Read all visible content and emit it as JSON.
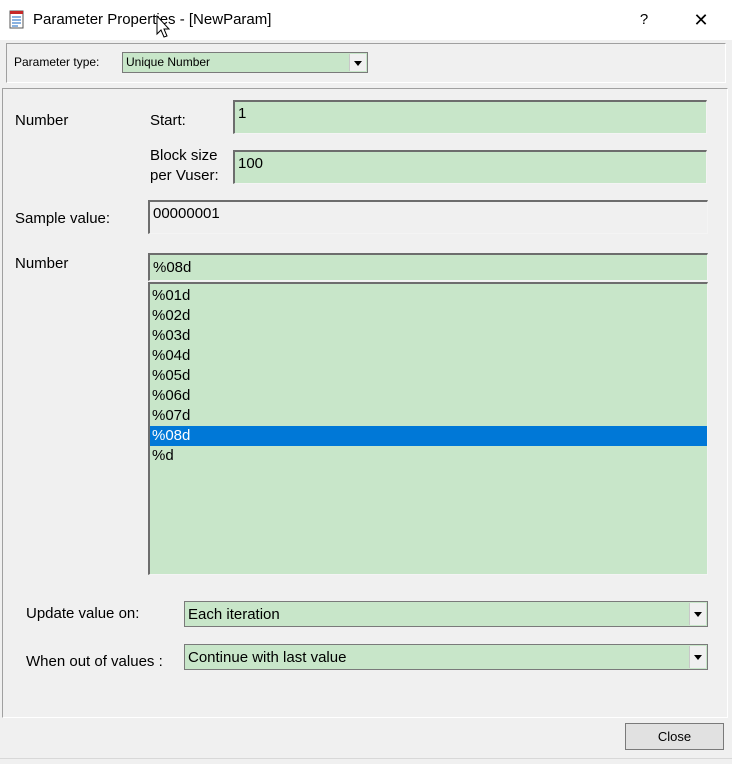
{
  "window": {
    "title": "Parameter Properties - [NewParam]",
    "help_label": "?",
    "close_label": "✕"
  },
  "parameter_type": {
    "label": "Parameter type:",
    "selected": "Unique Number"
  },
  "number": {
    "label": "Number",
    "start_label": "Start:",
    "start_value": "1",
    "block_label_line1": "Block size",
    "block_label_line2": "per Vuser:",
    "block_value": "100"
  },
  "sample": {
    "label": "Sample value:",
    "value": "00000001"
  },
  "format": {
    "label": "Number",
    "value": "%08d",
    "options": [
      "%01d",
      "%02d",
      "%03d",
      "%04d",
      "%05d",
      "%06d",
      "%07d",
      "%08d",
      "%d"
    ],
    "selected_index": 7
  },
  "update": {
    "label": "Update value on:",
    "selected": "Each iteration"
  },
  "out_of_values": {
    "label": "When out of values :",
    "selected": "Continue with last value"
  },
  "footer": {
    "close_button": "Close"
  },
  "colors": {
    "field_bg": "#c8e6c9",
    "selection": "#0078d7"
  }
}
